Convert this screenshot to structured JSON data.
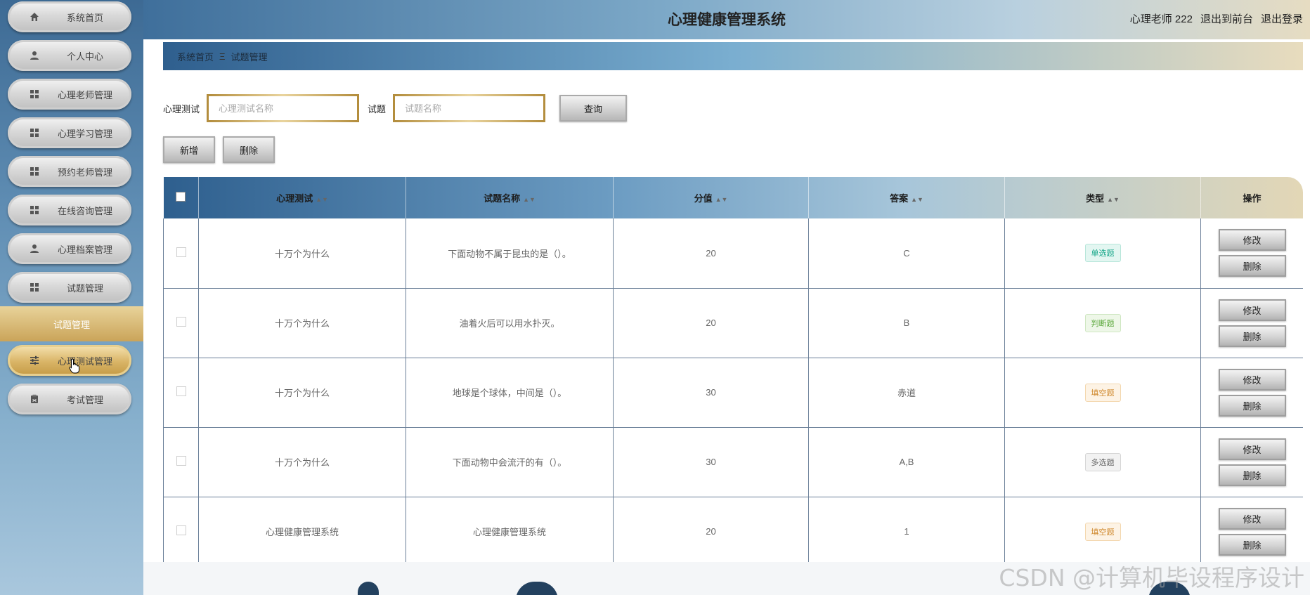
{
  "app": {
    "title": "心理健康管理系统"
  },
  "header": {
    "user_label": "心理老师 222",
    "front_link": "退出到前台",
    "logout_link": "退出登录"
  },
  "sidebar": {
    "items": [
      {
        "label": "系统首页",
        "icon": "home-icon"
      },
      {
        "label": "个人中心",
        "icon": "user-icon"
      },
      {
        "label": "心理老师管理",
        "icon": "grid-icon"
      },
      {
        "label": "心理学习管理",
        "icon": "grid-icon"
      },
      {
        "label": "预约老师管理",
        "icon": "grid-icon"
      },
      {
        "label": "在线咨询管理",
        "icon": "grid-icon"
      },
      {
        "label": "心理档案管理",
        "icon": "user-icon"
      },
      {
        "label": "试题管理",
        "icon": "grid-icon"
      }
    ],
    "section_label": "试题管理",
    "sub_items": [
      {
        "label": "心理测试管理",
        "icon": "sliders-icon",
        "active": true
      },
      {
        "label": "考试管理",
        "icon": "clipboard-icon"
      }
    ]
  },
  "breadcrumb": {
    "home": "系统首页",
    "separator": "Ξ",
    "current": "试题管理"
  },
  "search": {
    "test_label": "心理测试",
    "test_placeholder": "心理测试名称",
    "question_label": "试题",
    "question_placeholder": "试题名称",
    "query_button": "查询"
  },
  "actions": {
    "add_button": "新增",
    "delete_button": "删除"
  },
  "table": {
    "columns": [
      "心理测试",
      "试题名称",
      "分值",
      "答案",
      "类型",
      "操作"
    ],
    "rows": [
      {
        "test": "十万个为什么",
        "question": "下面动物不属于昆虫的是（）。",
        "score": "20",
        "answer": "C",
        "type": "单选题",
        "type_color": "teal"
      },
      {
        "test": "十万个为什么",
        "question": "油着火后可以用水扑灭。",
        "score": "20",
        "answer": "B",
        "type": "判断题",
        "type_color": "green"
      },
      {
        "test": "十万个为什么",
        "question": "地球是个球体，中间是（）。",
        "score": "30",
        "answer": "赤道",
        "type": "填空题",
        "type_color": "orange"
      },
      {
        "test": "十万个为什么",
        "question": "下面动物中会流汗的有（）。",
        "score": "30",
        "answer": "A,B",
        "type": "多选题",
        "type_color": "gray"
      },
      {
        "test": "心理健康管理系统",
        "question": "心理健康管理系统",
        "score": "20",
        "answer": "1",
        "type": "填空题",
        "type_color": "orange"
      }
    ],
    "edit_label": "修改",
    "delete_label": "删除"
  },
  "watermark": "CSDN @计算机毕设程序设计"
}
